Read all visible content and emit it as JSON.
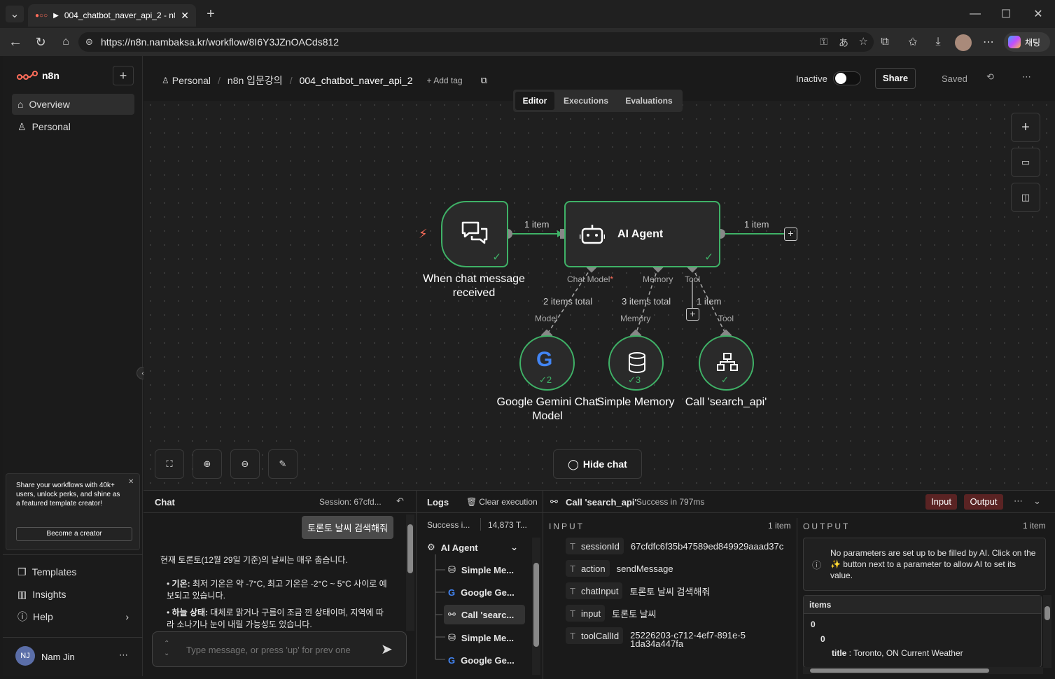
{
  "browser": {
    "tab_title": "004_chatbot_naver_api_2 - n8n",
    "url": "https://n8n.nambaksa.kr/workflow/8I6Y3JZnOACds812",
    "copilot_label": "채팅"
  },
  "sidebar": {
    "logo": "n8n",
    "items": [
      {
        "label": "Overview"
      },
      {
        "label": "Personal"
      }
    ],
    "promo_text": "Share your workflows with 40k+ users, unlock perks, and shine as a featured template creator!",
    "promo_button": "Become a creator",
    "bottom_items": [
      {
        "label": "Templates"
      },
      {
        "label": "Insights"
      },
      {
        "label": "Help"
      }
    ],
    "user_initials": "NJ",
    "user_name": "Nam Jin"
  },
  "header": {
    "breadcrumb_personal": "Personal",
    "breadcrumb_folder": "n8n 입문강의",
    "breadcrumb_workflow": "004_chatbot_naver_api_2",
    "add_tag": "+ Add tag",
    "status_label": "Inactive",
    "share_label": "Share",
    "saved_label": "Saved",
    "tabs": [
      {
        "label": "Editor"
      },
      {
        "label": "Executions"
      },
      {
        "label": "Evaluations"
      }
    ]
  },
  "canvas": {
    "trigger_label": "When chat message received",
    "agent_label": "AI Agent",
    "edge1_label": "1 item",
    "edge2_label": "1 item",
    "port_chat_model": "Chat Model",
    "port_memory": "Memory",
    "port_tool": "Tool",
    "sub_edge1": "2 items total",
    "sub_edge2": "3 items total",
    "sub_edge3": "1 item",
    "sub_in1": "Model",
    "sub_in2": "Memory",
    "sub_in3": "Tool",
    "gemini_label": "Google Gemini Chat Model",
    "memory_label": "Simple Memory",
    "tool_label": "Call 'search_api'",
    "gemini_count": "2",
    "memory_count": "3",
    "hide_chat": "Hide chat"
  },
  "chat": {
    "title": "Chat",
    "session": "Session: 67cfd...",
    "user_message": "토론토 날씨 검색해줘",
    "reply_intro": "현재 토론토(12월 29일 기준)의 날씨는 매우 춥습니다.",
    "bullet1_head": "기온:",
    "bullet1_text": "최저 기온은 약 -7°C, 최고 기온은 -2°C ~ 5°C 사이로 예보되고 있습니다.",
    "bullet2_head": "하늘 상태:",
    "bullet2_text": "대체로 맑거나 구름이 조금 낀 상태이며, 지역에 따라 소나기나 눈이 내릴 가능성도 있습니다.",
    "input_placeholder": "Type message, or press 'up' for prev one"
  },
  "logs": {
    "title": "Logs",
    "clear_label": "Clear execution",
    "summary_status": "Success i...",
    "summary_tokens": "14,873 T...",
    "rows": [
      {
        "label": "AI Agent"
      },
      {
        "label": "Simple Me..."
      },
      {
        "label": "Google Ge..."
      },
      {
        "label": "Call 'searc..."
      },
      {
        "label": "Simple Me..."
      },
      {
        "label": "Google Ge..."
      }
    ]
  },
  "details": {
    "node_name": "Call 'search_api'",
    "status": "Success in 797ms",
    "input_btn": "Input",
    "output_btn": "Output",
    "input_title": "INPUT",
    "input_count": "1 item",
    "output_title": "OUTPUT",
    "output_count": "1 item",
    "fields": [
      {
        "key": "sessionId",
        "value": "67cfdfc6f35b47589ed849929aaad37c"
      },
      {
        "key": "action",
        "value": "sendMessage"
      },
      {
        "key": "chatInput",
        "value": "토론토 날씨 검색해줘"
      },
      {
        "key": "input",
        "value": "토론토 날씨"
      },
      {
        "key": "toolCallId",
        "value": "25226203-c712-4ef7-891e-51da34a447fa"
      }
    ],
    "output_notice": "No parameters are set up to be filled by AI. Click on the ✨ button next to a parameter to allow AI to set its value.",
    "items_header": "items",
    "tree_index0": "0",
    "tree_index1": "0",
    "tree_key": "title",
    "tree_value": "Toronto, ON Current Weather"
  },
  "colors": {
    "accent": "#ff6d5a",
    "success": "#3fb267",
    "bg": "#1f1f1f"
  }
}
